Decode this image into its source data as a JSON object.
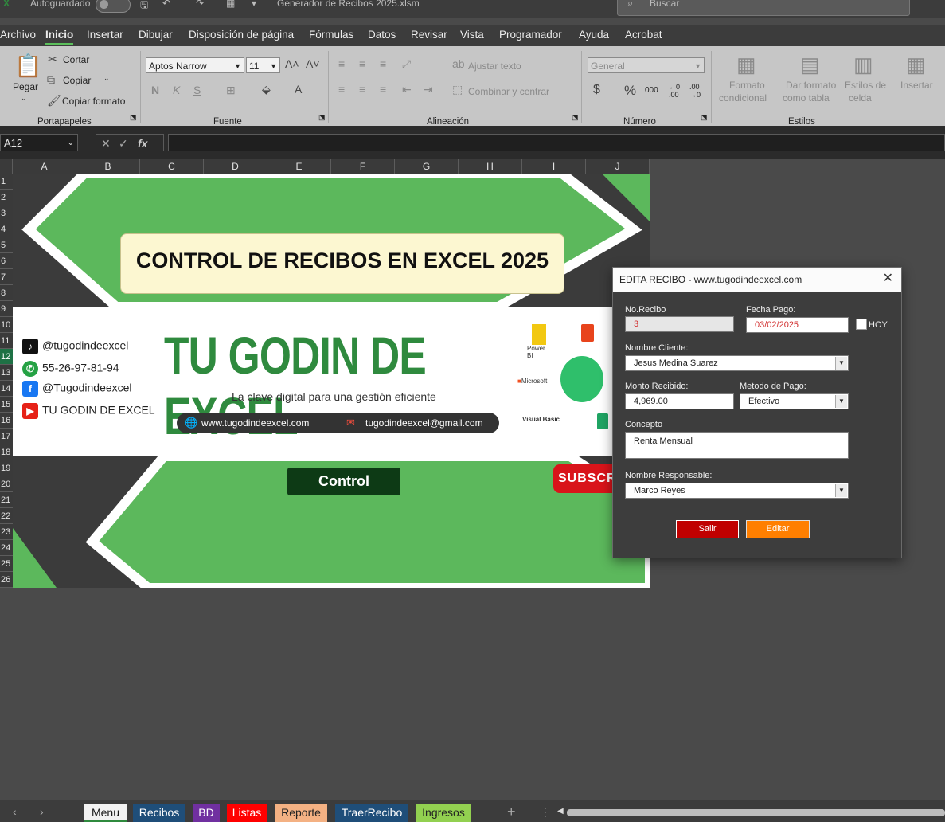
{
  "titlebar": {
    "autosave_label": "Autoguardado",
    "file_name": "Generador de Recibos 2025.xlsm",
    "search_placeholder": "Buscar"
  },
  "menu": [
    "Archivo",
    "Inicio",
    "Insertar",
    "Dibujar",
    "Disposición de página",
    "Fórmulas",
    "Datos",
    "Revisar",
    "Vista",
    "Programador",
    "Ayuda",
    "Acrobat"
  ],
  "menu_active": "Inicio",
  "ribbon": {
    "clipboard": {
      "paste": "Pegar",
      "cut": "Cortar",
      "copy": "Copiar",
      "format_painter": "Copiar formato",
      "group": "Portapapeles"
    },
    "font": {
      "name": "Aptos Narrow",
      "size": "11",
      "bold": "N",
      "italic": "K",
      "underline": "S",
      "group": "Fuente"
    },
    "alignment": {
      "wrap": "Ajustar texto",
      "merge": "Combinar y centrar",
      "group": "Alineación"
    },
    "number": {
      "format": "General",
      "currency": "$",
      "percent": "%",
      "thousands": "000",
      "group": "Número"
    },
    "styles": {
      "conditional_1": "Formato",
      "conditional_2": "condicional",
      "table_1": "Dar formato",
      "table_2": "como tabla",
      "cell_1": "Estilos de",
      "cell_2": "celda",
      "group": "Estilos"
    },
    "cells": {
      "insert": "Insertar"
    }
  },
  "formula_bar": {
    "name_box": "A12",
    "fx": "fx",
    "value": ""
  },
  "columns": [
    "A",
    "B",
    "C",
    "D",
    "E",
    "F",
    "G",
    "H",
    "I",
    "J"
  ],
  "rows": [
    "1",
    "2",
    "3",
    "4",
    "5",
    "6",
    "7",
    "8",
    "9",
    "10",
    "11",
    "12",
    "13",
    "14",
    "15",
    "16",
    "17",
    "18",
    "19",
    "20",
    "21",
    "22",
    "23",
    "24",
    "25",
    "26"
  ],
  "selected_row": "12",
  "banner": {
    "title": "CONTROL DE RECIBOS EN EXCEL 2025",
    "brand": "TU GODIN DE EXCEL",
    "tagline": "La clave digital para una gestión eficiente",
    "socials": [
      "@tugodindeexcel",
      "55-26-97-81-94",
      "@Tugodindeexcel",
      "TU GODIN DE EXCEL"
    ],
    "website": "www.tugodindeexcel.com",
    "email": "tugodindeexcel@gmail.com",
    "logo_powerbi": "Power BI",
    "logo_microsoft": "Microsoft",
    "logo_vba": "Visual Basic",
    "control_button": "Control",
    "subscribe": "SUBSCR"
  },
  "dialog": {
    "title": "EDITA RECIBO - www.tugodindeexcel.com",
    "no_recibo_label": "No.Recibo",
    "no_recibo_value": "3",
    "fecha_label": "Fecha Pago:",
    "fecha_value": "03/02/2025",
    "hoy_label": "HOY",
    "cliente_label": "Nombre Cliente:",
    "cliente_value": "Jesus Medina Suarez",
    "monto_label": "Monto Recibido:",
    "monto_value": "4,969.00",
    "metodo_label": "Metodo de Pago:",
    "metodo_value": "Efectivo",
    "concepto_label": "Concepto",
    "concepto_value": "Renta Mensual",
    "responsable_label": "Nombre Responsable:",
    "responsable_value": "Marco Reyes",
    "salir": "Salir",
    "editar": "Editar"
  },
  "sheet_tabs": [
    {
      "label": "Menu",
      "color": "#f2f2f2"
    },
    {
      "label": "Recibos",
      "color": "#1f4e79"
    },
    {
      "label": "BD",
      "color": "#7030a0"
    },
    {
      "label": "Listas",
      "color": "#ff0000"
    },
    {
      "label": "Reporte",
      "color": "#f4b183"
    },
    {
      "label": "TraerRecibo",
      "color": "#1f4e79"
    },
    {
      "label": "Ingresos",
      "color": "#92d050"
    }
  ],
  "colors": {
    "green": "#2f8a3e",
    "banner_green": "#5cb85c",
    "dark": "#333333"
  }
}
